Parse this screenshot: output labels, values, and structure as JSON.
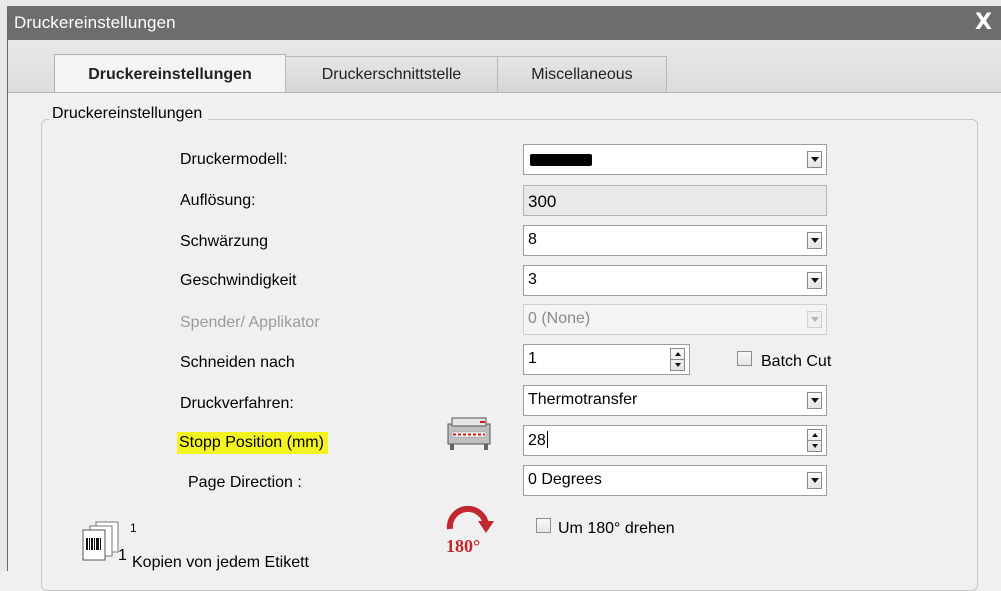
{
  "window": {
    "title": "Druckereinstellungen"
  },
  "tabs": [
    {
      "label": "Druckereinstellungen",
      "active": true
    },
    {
      "label": "Druckerschnittstelle",
      "active": false
    },
    {
      "label": "Miscellaneous",
      "active": false
    }
  ],
  "group": {
    "title": "Druckereinstellungen"
  },
  "fields": {
    "model": {
      "label": "Druckermodell:",
      "value": ""
    },
    "resolution": {
      "label": "Auflösung:",
      "value": "300"
    },
    "darkness": {
      "label": "Schwärzung",
      "value": "8"
    },
    "speed": {
      "label": "Geschwindigkeit",
      "value": "3"
    },
    "dispenser": {
      "label": "Spender/ Applikator",
      "value": "0 (None)"
    },
    "cut": {
      "label": "Schneiden nach",
      "value": "1"
    },
    "batch_cut": {
      "label": "Batch Cut",
      "checked": false
    },
    "method": {
      "label": "Druckverfahren:",
      "value": "Thermotransfer"
    },
    "stop_position": {
      "label": "Stopp Position (mm)",
      "value": "28"
    },
    "page_direction": {
      "label": "Page Direction :",
      "value": "0 Degrees"
    },
    "rotate": {
      "label": "Um 180° drehen",
      "checked": false,
      "icon_text": "180°"
    }
  },
  "copies": {
    "badge": "1",
    "text": "Kopien von jedem Etikett",
    "count": "1"
  },
  "colors": {
    "titlebar": "#6d6d6d",
    "highlight": "#f3f31f",
    "rotate_icon": "#c1272d"
  }
}
